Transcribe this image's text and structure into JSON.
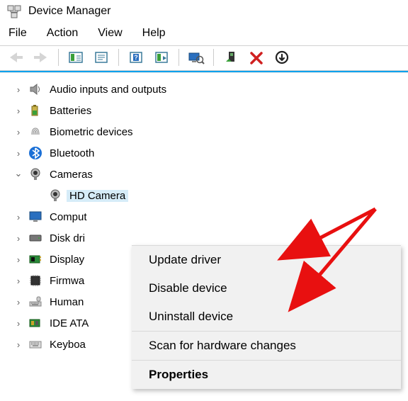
{
  "window": {
    "title": "Device Manager"
  },
  "menubar": {
    "file": "File",
    "action": "Action",
    "view": "View",
    "help": "Help"
  },
  "tree": {
    "audio": "Audio inputs and outputs",
    "batteries": "Batteries",
    "biometric": "Biometric devices",
    "bluetooth": "Bluetooth",
    "cameras": "Cameras",
    "hd_camera": "HD Camera",
    "computer": "Comput",
    "disk": "Disk dri",
    "display": "Display",
    "firmware": "Firmwa",
    "human": "Human",
    "ide": "IDE ATA",
    "keyboard": "Keyboa"
  },
  "context_menu": {
    "update": "Update driver",
    "disable": "Disable device",
    "uninstall": "Uninstall device",
    "scan": "Scan for hardware changes",
    "properties": "Properties"
  }
}
